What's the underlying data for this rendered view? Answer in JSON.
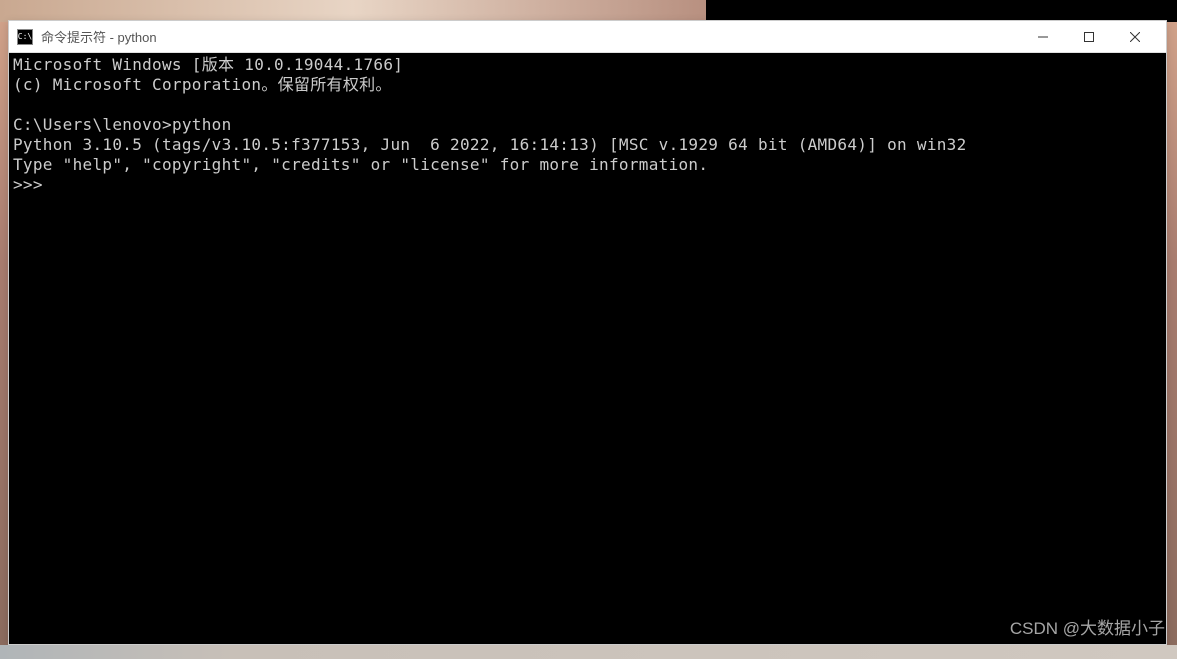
{
  "titlebar": {
    "icon_text": "C:\\",
    "title": "命令提示符 - python"
  },
  "terminal": {
    "line1": "Microsoft Windows [版本 10.0.19044.1766]",
    "line2": "(c) Microsoft Corporation。保留所有权利。",
    "line3": "",
    "prompt_path": "C:\\Users\\lenovo>",
    "prompt_cmd": "python",
    "line5": "Python 3.10.5 (tags/v3.10.5:f377153, Jun  6 2022, 16:14:13) [MSC v.1929 64 bit (AMD64)] on win32",
    "line6": "Type \"help\", \"copyright\", \"credits\" or \"license\" for more information.",
    "repl_prompt": ">>> "
  },
  "watermark": "CSDN @大数据小子"
}
